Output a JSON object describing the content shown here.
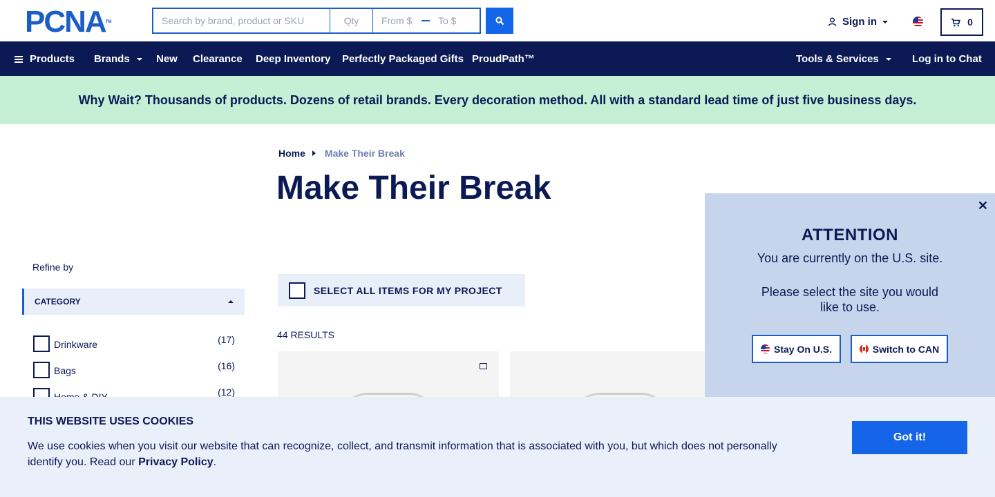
{
  "header": {
    "logo_text": "PCNA",
    "logo_tm": "TM",
    "search": {
      "main_placeholder": "Search by brand, product or SKU",
      "qty_placeholder": "Qty",
      "from_placeholder": "From $",
      "to_placeholder": "To $"
    },
    "signin_label": "Sign in",
    "cart_count": "0"
  },
  "nav": {
    "products": "Products",
    "brands": "Brands",
    "new": "New",
    "clearance": "Clearance",
    "deep_inventory": "Deep Inventory",
    "gifts": "Perfectly Packaged Gifts",
    "proudpath": "ProudPath™",
    "tools": "Tools & Services",
    "chat": "Log in to Chat"
  },
  "promo": "Why Wait? Thousands of products. Dozens of retail brands. Every decoration method. All with a standard lead time of just five business days.",
  "breadcrumb": {
    "home": "Home",
    "current": "Make Their Break"
  },
  "page_title": "Make Their Break",
  "sidebar": {
    "refine_label": "Refine by",
    "category_header": "CATEGORY",
    "facets": [
      {
        "label": "Drinkware",
        "count": "(17)"
      },
      {
        "label": "Bags",
        "count": "(16)"
      },
      {
        "label": "Home & DIY",
        "count": "(12)"
      }
    ]
  },
  "main": {
    "select_all_label": "SELECT ALL ITEMS FOR MY PROJECT",
    "results_label": "44 RESULTS"
  },
  "attention": {
    "title": "ATTENTION",
    "line1": "You are currently on the U.S. site.",
    "line2": "Please select the site you would like to use.",
    "stay_label": "Stay On U.S.",
    "switch_label": "Switch to CAN"
  },
  "cookie": {
    "title": "THIS WEBSITE USES COOKIES",
    "text_before": "We use cookies when you visit our website that can recognize, collect, and transmit information that is associated with you, but which does not personally identify you. Read our ",
    "link": "Privacy Policy",
    "text_after": ".",
    "button": "Got it!"
  },
  "colors": {
    "navy": "#0b1a55",
    "brand_blue": "#1565e8",
    "promo_green": "#c5f0d6",
    "modal_bg": "#c6d5ec",
    "cookie_bg": "#eaf0fa"
  },
  "icons": {
    "search": "search-icon",
    "user": "user-icon",
    "cart": "cart-icon",
    "menu": "menu-icon",
    "close": "close-icon",
    "folder": "folder-icon"
  }
}
